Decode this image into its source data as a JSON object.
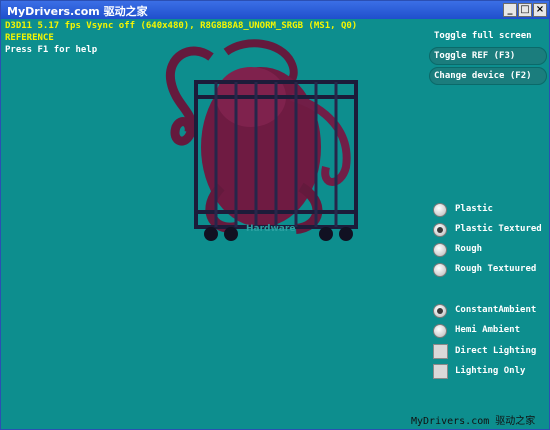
{
  "window": {
    "title": "MyDrivers.com 驱动之家",
    "buttons": {
      "minimize": "_",
      "maximize": "□",
      "close": "×"
    }
  },
  "stats": {
    "line1": "D3D11 5.17 fps Vsync off (640x480), R8G8B8A8_UNORM_SRGB (MS1, Q0)",
    "line2": "REFERENCE",
    "help": "Press F1 for help"
  },
  "top_buttons": [
    {
      "label": "Toggle full screen"
    },
    {
      "label": "Toggle REF (F3)"
    },
    {
      "label": "Change device (F2)"
    }
  ],
  "material_options": [
    {
      "label": "Plastic",
      "selected": false
    },
    {
      "label": "Plastic Textured",
      "selected": true
    },
    {
      "label": "Rough",
      "selected": false
    },
    {
      "label": "Rough Textuured",
      "selected": false
    }
  ],
  "lighting_options": [
    {
      "label": "ConstantAmbient",
      "selected": true
    },
    {
      "label": "Hemi Ambient",
      "selected": false
    }
  ],
  "checkbox_options": [
    {
      "label": "Direct Lighting",
      "checked": false
    },
    {
      "label": "Lighting Only",
      "checked": false
    }
  ],
  "watermark": "Hardware",
  "credit": "MyDrivers.com 驱动之家"
}
